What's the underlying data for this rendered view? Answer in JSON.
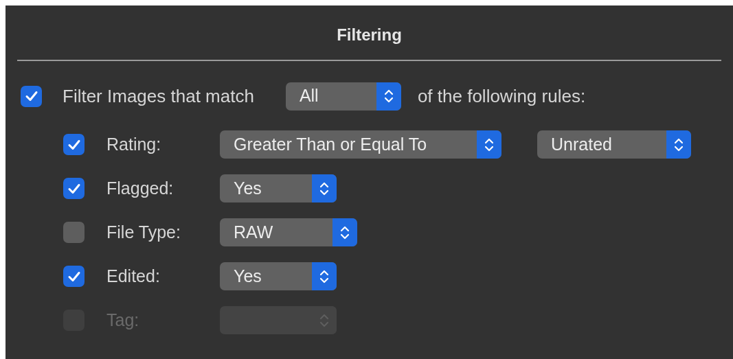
{
  "title": "Filtering",
  "filter": {
    "checked": true,
    "label": "Filter Images that match",
    "match": {
      "kind": "popup",
      "value": "All"
    },
    "suffix": "of the following rules:"
  },
  "rules": [
    {
      "label": "Rating:",
      "checked": true,
      "disabled": false,
      "selects": [
        {
          "kind": "popup",
          "value": "Greater Than or Equal To"
        },
        {
          "kind": "popup",
          "value": "Unrated"
        }
      ]
    },
    {
      "label": "Flagged:",
      "checked": true,
      "disabled": false,
      "selects": [
        {
          "kind": "popup",
          "value": "Yes"
        }
      ]
    },
    {
      "label": "File Type:",
      "checked": false,
      "disabled": false,
      "selects": [
        {
          "kind": "popup",
          "value": "RAW"
        }
      ]
    },
    {
      "label": "Edited:",
      "checked": true,
      "disabled": false,
      "selects": [
        {
          "kind": "popup",
          "value": "Yes"
        }
      ]
    },
    {
      "label": "Tag:",
      "checked": false,
      "disabled": true,
      "selects": [
        {
          "kind": "popup"
        }
      ]
    }
  ]
}
